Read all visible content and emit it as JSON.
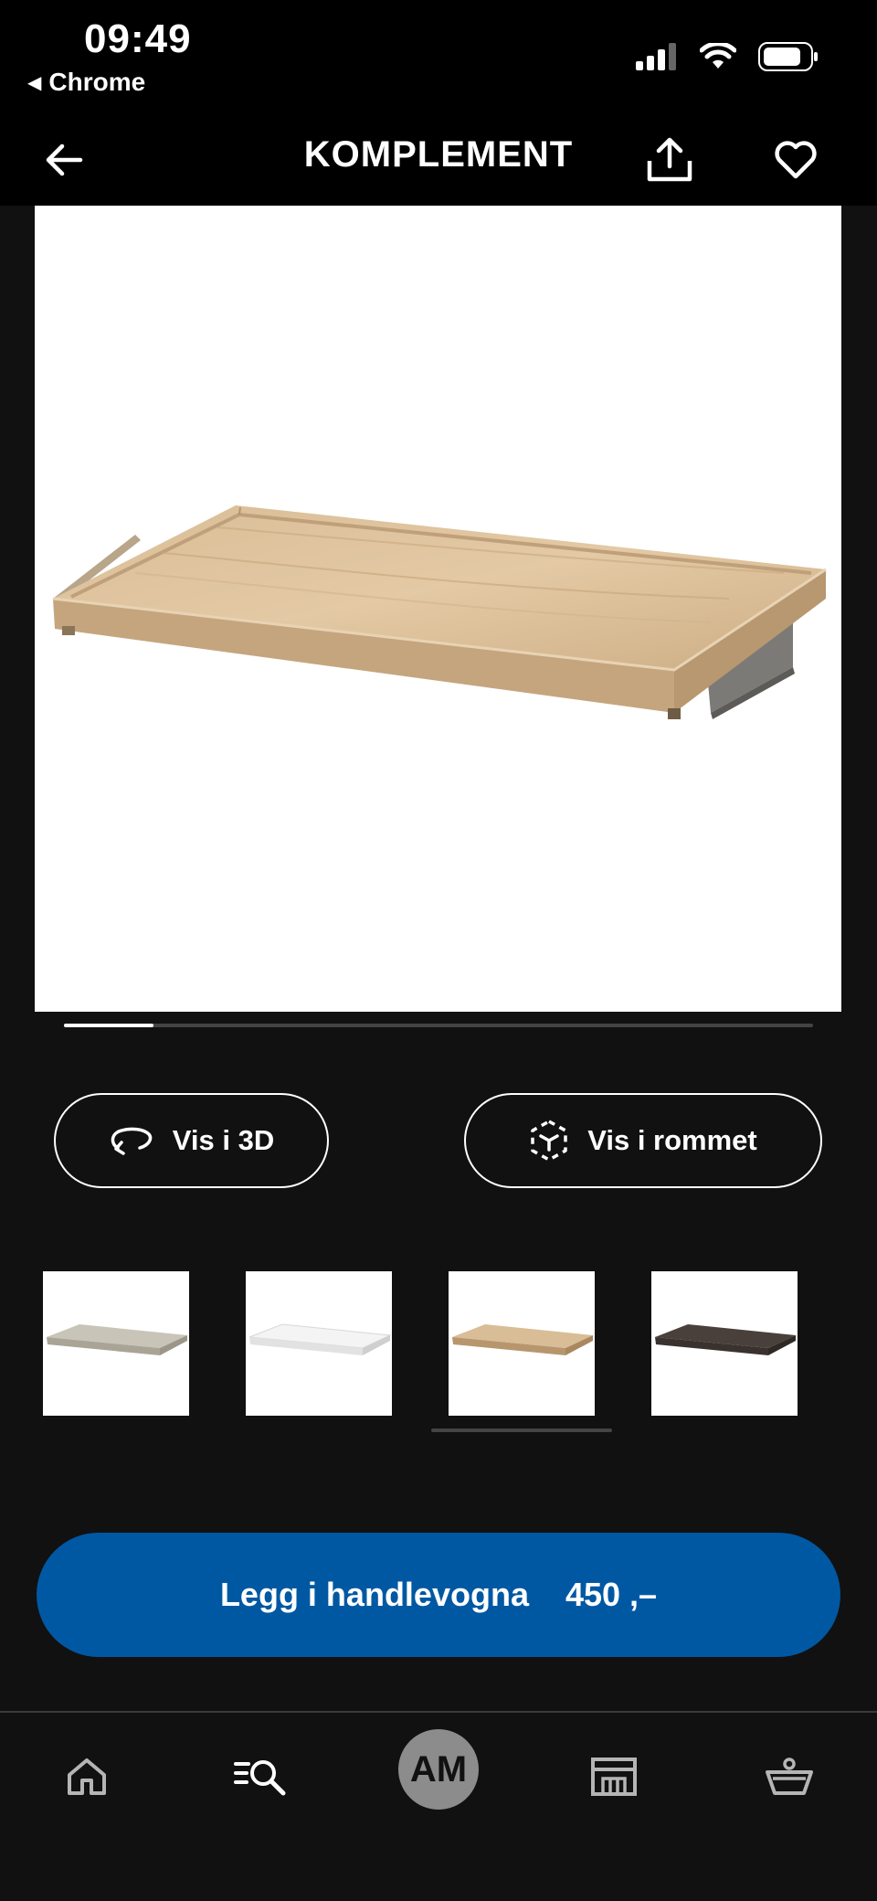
{
  "status_bar": {
    "time": "09:49",
    "back_app": "Chrome"
  },
  "header": {
    "title": "KOMPLEMENT"
  },
  "gallery": {
    "progress": 0.12
  },
  "actions": {
    "view_3d": "Vis i 3D",
    "view_room": "Vis i rommet"
  },
  "variants": [
    {
      "name": "grey-beige",
      "color": "#c9c4b8"
    },
    {
      "name": "white",
      "color": "#f2f2f2"
    },
    {
      "name": "white-stained-oak",
      "color": "#c8a97e"
    },
    {
      "name": "dark-brown",
      "color": "#4a403b"
    }
  ],
  "cta": {
    "label": "Legg i handlevogna",
    "price": "450 ,–"
  },
  "bottom_nav": {
    "avatar_initials": "AM"
  },
  "colors": {
    "accent": "#0058a3",
    "background": "#111111"
  }
}
